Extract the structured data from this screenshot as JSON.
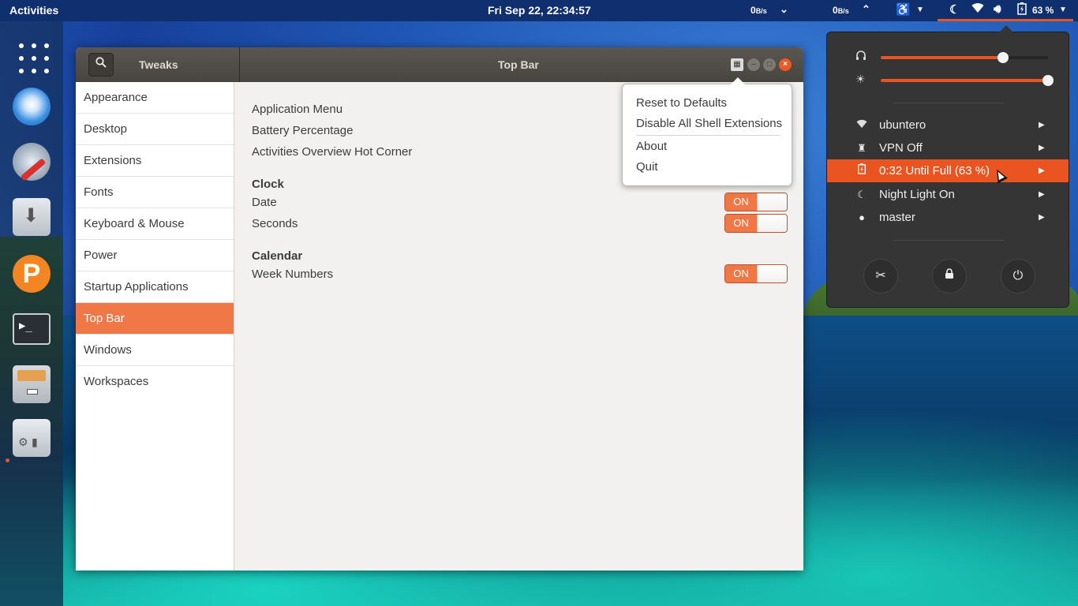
{
  "topbar": {
    "activities": "Activities",
    "clock": "Fri Sep 22, 22:34:57",
    "net_down_value": "0",
    "net_down_unit": "B/s",
    "net_up_value": "0",
    "net_up_unit": "B/s",
    "battery": "63 %",
    "icons": [
      "chevron-down-icon",
      "chevron-up-icon",
      "accessibility-icon",
      "night-light-icon",
      "wifi-icon",
      "volume-icon",
      "battery-charging-icon"
    ],
    "accent": "#e95420"
  },
  "dock": {
    "apps": [
      "show-applications",
      "browser",
      "settings",
      "downloader",
      "p-app",
      "terminal",
      "files",
      "tweaks"
    ],
    "terminal_glyph": "▶_"
  },
  "window": {
    "app_title": "Tweaks",
    "title": "Top Bar",
    "sidebar": {
      "items": [
        {
          "label": "Appearance"
        },
        {
          "label": "Desktop"
        },
        {
          "label": "Extensions"
        },
        {
          "label": "Fonts"
        },
        {
          "label": "Keyboard & Mouse"
        },
        {
          "label": "Power"
        },
        {
          "label": "Startup Applications"
        },
        {
          "label": "Top Bar",
          "active": true
        },
        {
          "label": "Windows"
        },
        {
          "label": "Workspaces"
        }
      ]
    },
    "content": {
      "settings": [
        "Application Menu",
        "Battery Percentage",
        "Activities Overview Hot Corner"
      ],
      "clock_heading": "Clock",
      "date_label": "Date",
      "date_switch": "ON",
      "seconds_label": "Seconds",
      "seconds_switch": "ON",
      "calendar_heading": "Calendar",
      "week_numbers_label": "Week Numbers",
      "week_numbers_switch": "ON"
    },
    "accent": "#f07746"
  },
  "popover": {
    "items": [
      "Reset to Defaults",
      "Disable All Shell Extensions",
      "About",
      "Quit"
    ]
  },
  "system_menu": {
    "volume_level": 0.73,
    "brightness_level": 1.0,
    "items": [
      {
        "icon": "wifi-icon",
        "label": "ubuntero"
      },
      {
        "icon": "vpn-icon",
        "label": "VPN Off"
      },
      {
        "icon": "battery-charging-icon",
        "label": "0:32 Until Full (63 %)",
        "active": true
      },
      {
        "icon": "night-light-icon",
        "label": "Night Light On"
      },
      {
        "icon": "user-icon",
        "label": "master"
      }
    ],
    "buttons": [
      "settings-button",
      "lock-button",
      "power-button"
    ]
  }
}
